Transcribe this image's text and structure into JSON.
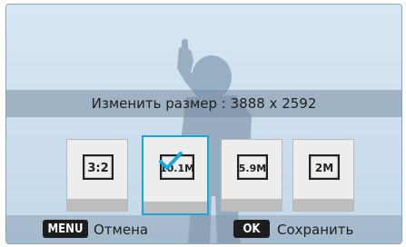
{
  "info": {
    "resize_label": "Изменить размер : 3888 x 2592"
  },
  "options": [
    {
      "label": "3:2",
      "selected": false
    },
    {
      "label": "10.1M",
      "selected": true
    },
    {
      "label": "5.9M",
      "selected": false
    },
    {
      "label": "2M",
      "selected": false
    }
  ],
  "bottom": {
    "menu_key": "MENU",
    "cancel_label": "Отмена",
    "ok_key": "OK",
    "save_label": "Сохранить"
  },
  "colors": {
    "accent": "#16a7de",
    "screen_bg": "#cfe0ef"
  }
}
